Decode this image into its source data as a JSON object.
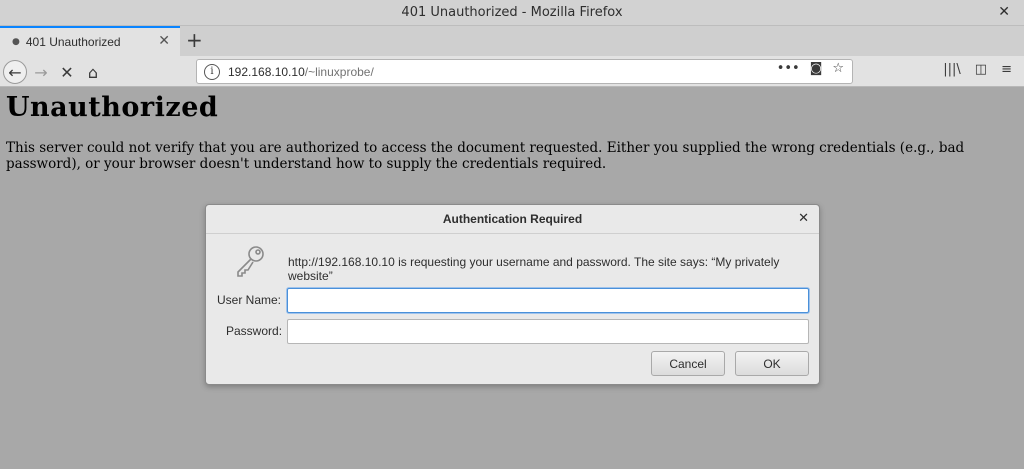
{
  "window": {
    "title": "401 Unauthorized - Mozilla Firefox",
    "close_glyph": "✕"
  },
  "tabs": [
    {
      "label": "401 Unauthorized",
      "close_glyph": "✕"
    }
  ],
  "newtab_glyph": "+",
  "nav": {
    "back_glyph": "←",
    "forward_glyph": "→",
    "stop_glyph": "✕",
    "home_glyph": "⌂",
    "url_host": "192.168.10.10",
    "url_path": "/~linuxprobe/",
    "page_actions_glyph": "•••",
    "pocket_glyph": "◙",
    "bookmark_glyph": "☆",
    "library_glyph": "|||\\",
    "sidebar_glyph": "◫",
    "menu_glyph": "≡"
  },
  "page": {
    "heading": "Unauthorized",
    "body": "This server could not verify that you are authorized to access the document requested. Either you supplied the wrong credentials (e.g., bad password), or your browser doesn't understand how to supply the credentials required."
  },
  "dialog": {
    "title": "Authentication Required",
    "close_glyph": "✕",
    "message": "http://192.168.10.10 is requesting your username and password. The site says: “My privately website”",
    "username_label": "User Name:",
    "username_value": "",
    "password_label": "Password:",
    "password_value": "",
    "cancel_label": "Cancel",
    "ok_label": "OK"
  }
}
